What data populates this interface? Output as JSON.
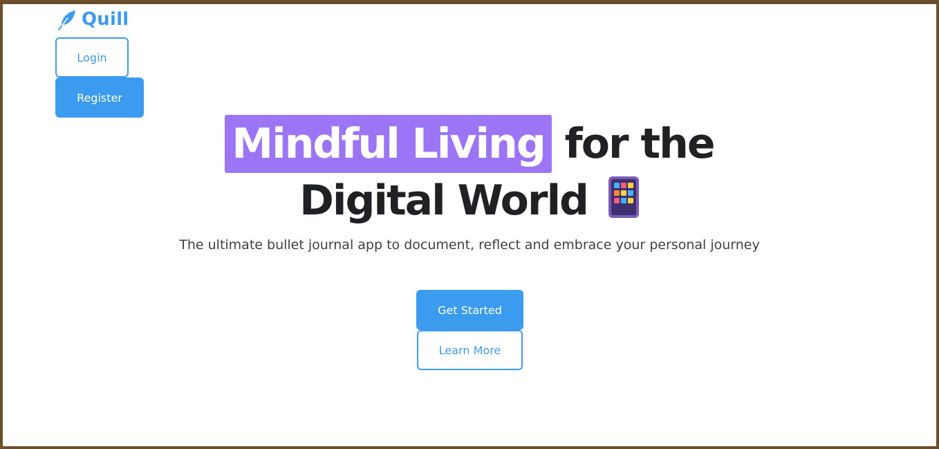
{
  "brand": {
    "name": "Quill",
    "logo_icon": "feather-icon",
    "color": "#3a9bef"
  },
  "nav": {
    "login_label": "Login",
    "register_label": "Register"
  },
  "hero": {
    "title_highlight": "Mindful Living",
    "title_rest_line1": "for the",
    "title_line2": "Digital World",
    "title_icon": "tablet-icon",
    "highlight_color": "#9b75f6",
    "subtitle": "The ultimate bullet journal app to document, reflect and embrace your personal journey"
  },
  "cta": {
    "primary_label": "Get Started",
    "secondary_label": "Learn More"
  },
  "colors": {
    "accent": "#3a9bef",
    "text_dark": "#1f2124",
    "frame_border": "#6b4f2a"
  }
}
